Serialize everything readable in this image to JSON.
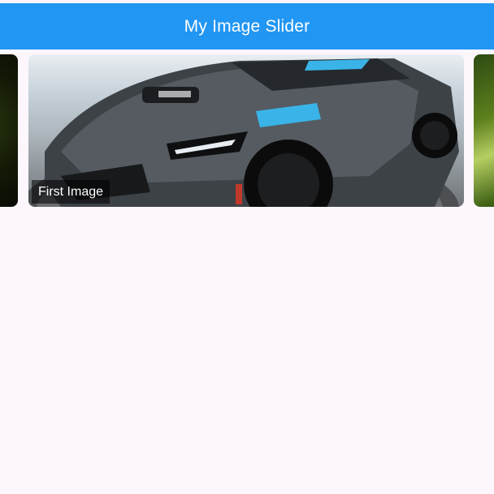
{
  "app_bar": {
    "title": "My Image Slider"
  },
  "slider": {
    "current_index": 0,
    "slides": [
      {
        "caption": "First Image"
      }
    ]
  },
  "colors": {
    "accent": "#2196f3",
    "background": "#fdf6fd",
    "caption_bg": "rgba(0,0,0,0.55)",
    "caption_text": "#ffffff"
  },
  "icons": {
    "car": "car-icon"
  }
}
